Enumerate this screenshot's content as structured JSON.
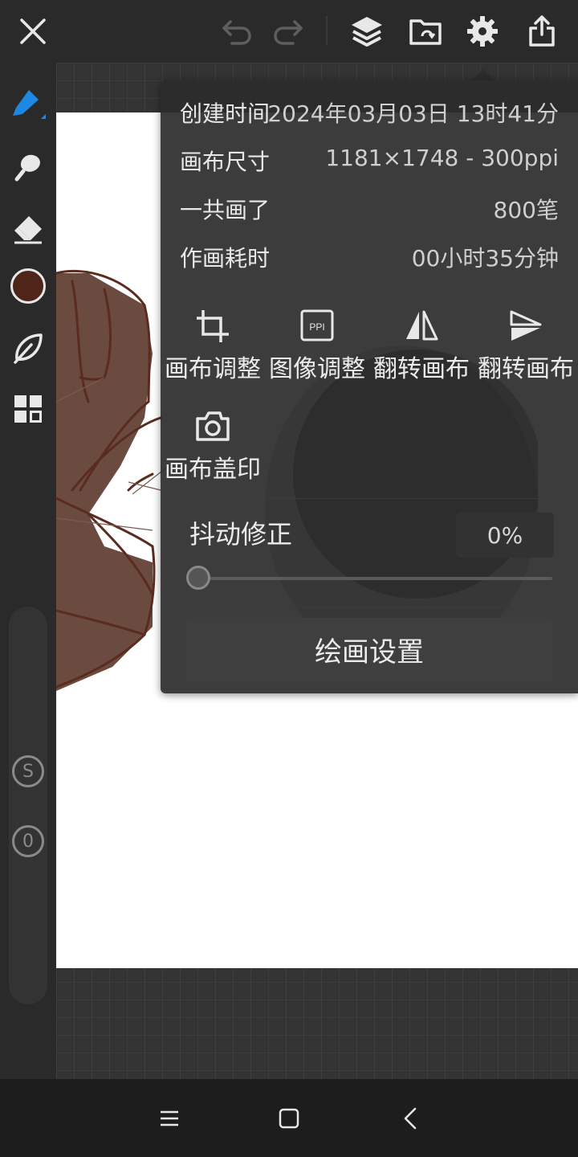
{
  "colors": {
    "accent": "#1e88e5",
    "current_color": "#4e2518",
    "panel_bg": "#2b2b2b",
    "hair_fill": "#6b4a40",
    "line_color": "#5a2c20"
  },
  "topbar": {
    "icons": [
      "close-icon",
      "undo-icon",
      "redo-icon",
      "layers-icon",
      "folder-sync-icon",
      "gear-icon",
      "share-icon"
    ]
  },
  "toolbar": {
    "tools": [
      "brush-icon",
      "smudge-icon",
      "eraser-icon",
      "color-swatch",
      "leaf-icon",
      "grid-icon"
    ],
    "mode_s": "S",
    "mode_0": "0"
  },
  "panel": {
    "info": [
      {
        "label": "创建时间",
        "value": "2024年03月03日 13时41分"
      },
      {
        "label": "画布尺寸",
        "value": "1181×1748 - 300ppi"
      },
      {
        "label": "一共画了",
        "value": "800笔"
      },
      {
        "label": "作画耗时",
        "value": "00小时35分钟"
      }
    ],
    "tools": [
      {
        "label": "画布调整",
        "icon": "crop-icon"
      },
      {
        "label": "图像调整",
        "icon": "ppi-icon"
      },
      {
        "label": "翻转画布",
        "icon": "flip-horizontal-icon"
      },
      {
        "label": "翻转画布",
        "icon": "flip-vertical-icon"
      },
      {
        "label": "画布盖印",
        "icon": "camera-icon"
      }
    ],
    "ppi_text": "PPI",
    "stabilizer": {
      "label": "抖动修正",
      "value": "0%",
      "level": 0
    },
    "settings_button": "绘画设置"
  },
  "navbar": {
    "icons": [
      "menu-icon",
      "home-icon",
      "back-icon"
    ]
  }
}
